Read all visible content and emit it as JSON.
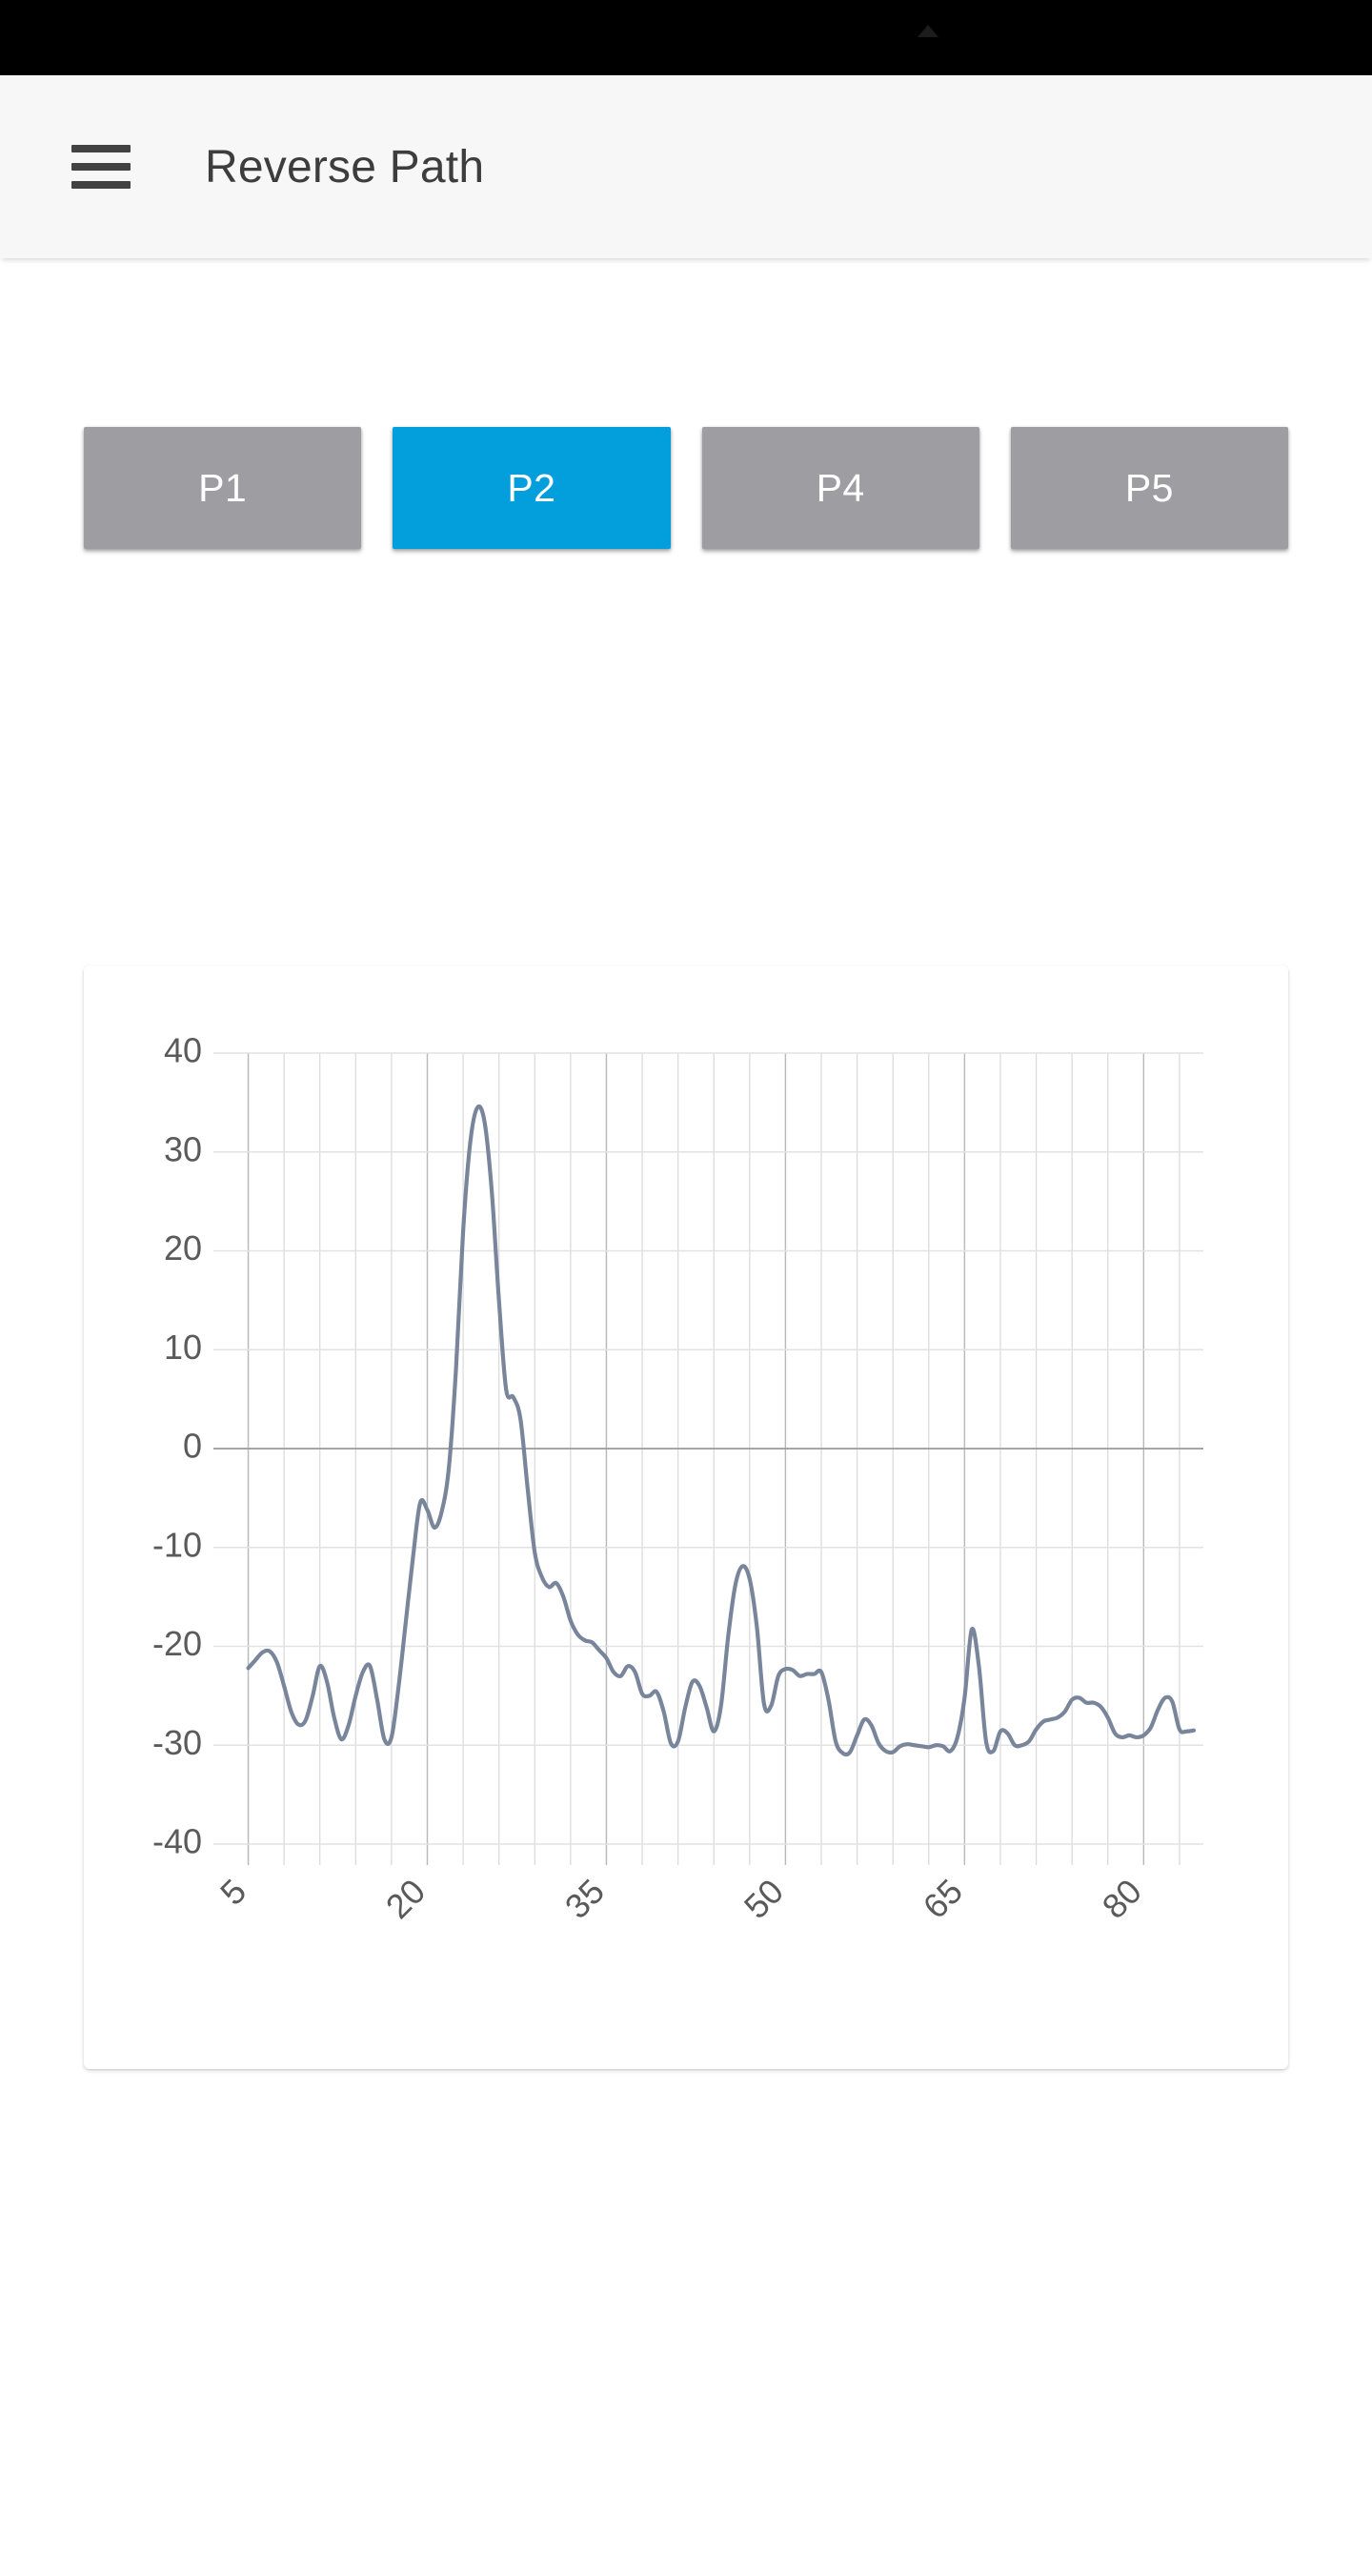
{
  "statusbar": {
    "notch_icon": "camera-notch"
  },
  "appbar": {
    "menu_icon": "hamburger-menu-icon",
    "title": "Reverse Path"
  },
  "buttons": [
    {
      "label": "P1",
      "active": false
    },
    {
      "label": "P2",
      "active": true
    },
    {
      "label": "P4",
      "active": false
    },
    {
      "label": "P5",
      "active": false
    }
  ],
  "colors": {
    "accent": "#039fdc",
    "inactive": "#9e9ea2",
    "line": "#78859b",
    "appbar_bg": "#f7f7f7",
    "statusbar_bg": "#000000",
    "text": "#3d3d3d",
    "tick_text": "#5a5a5a"
  },
  "chart_data": {
    "type": "line",
    "title": "",
    "xlabel": "",
    "ylabel": "",
    "xlim": [
      4,
      85
    ],
    "ylim": [
      -40,
      40
    ],
    "yticks": [
      40,
      30,
      20,
      10,
      0,
      -10,
      -20,
      -30,
      -40
    ],
    "ytick_labels": [
      "40",
      "30",
      "20",
      "10",
      "0",
      "-10",
      "-20",
      "-30",
      "-40"
    ],
    "xticks": [
      5,
      20,
      35,
      50,
      65,
      80
    ],
    "xtick_labels": [
      "5",
      "20",
      "35",
      "50",
      "65",
      "80"
    ],
    "xtick_rotation": -45,
    "grid": true,
    "grid_minor_x_step": 3,
    "legend": false,
    "series": [
      {
        "name": "P2",
        "color": "#78859b",
        "x": [
          5.0,
          5.6,
          6.2,
          6.8,
          7.4,
          8.0,
          8.6,
          9.2,
          9.8,
          10.4,
          11.0,
          11.6,
          12.2,
          12.8,
          13.4,
          14.0,
          14.6,
          15.2,
          15.8,
          16.4,
          17.0,
          17.6,
          18.2,
          18.8,
          19.4,
          20.0,
          20.6,
          21.2,
          21.8,
          22.4,
          23.0,
          23.6,
          24.2,
          24.8,
          25.4,
          26.0,
          26.6,
          27.2,
          27.8,
          28.4,
          29.0,
          29.6,
          30.2,
          30.8,
          31.4,
          32.0,
          32.6,
          33.2,
          33.8,
          34.4,
          35.0,
          35.6,
          36.2,
          36.8,
          37.4,
          38.0,
          38.6,
          39.2,
          39.8,
          40.4,
          41.0,
          41.6,
          42.2,
          42.8,
          43.4,
          44.0,
          44.6,
          45.2,
          45.8,
          46.4,
          47.0,
          47.6,
          48.2,
          48.8,
          49.4,
          50.0,
          50.6,
          51.2,
          51.8,
          52.4,
          53.0,
          53.6,
          54.2,
          54.8,
          55.4,
          56.0,
          56.6,
          57.2,
          57.8,
          58.4,
          59.0,
          59.6,
          60.2,
          60.8,
          61.4,
          62.0,
          62.6,
          63.2,
          63.8,
          64.4,
          65.0,
          65.6,
          66.2,
          66.8,
          67.4,
          68.0,
          68.6,
          69.2,
          69.8,
          70.4,
          71.0,
          71.6,
          72.2,
          72.8,
          73.4,
          74.0,
          74.6,
          75.2,
          75.8,
          76.4,
          77.0,
          77.6,
          78.2,
          78.8,
          79.4,
          80.0,
          80.6,
          81.2,
          81.8,
          82.4,
          83.0,
          83.6,
          84.2
        ],
        "y": [
          -22.2,
          -21.4,
          -20.6,
          -20.5,
          -21.6,
          -24.0,
          -26.6,
          -27.9,
          -27.5,
          -25.0,
          -22.0,
          -23.6,
          -27.2,
          -29.4,
          -28.0,
          -25.0,
          -22.6,
          -22.0,
          -25.4,
          -29.4,
          -29.2,
          -24.0,
          -17.5,
          -11.0,
          -5.5,
          -6.2,
          -8.0,
          -6.4,
          -2.0,
          8.0,
          22.0,
          31.0,
          34.5,
          33.0,
          26.0,
          15.0,
          6.0,
          5.2,
          3.0,
          -4.0,
          -10.5,
          -13.0,
          -14.0,
          -13.6,
          -15.0,
          -17.4,
          -18.8,
          -19.4,
          -19.6,
          -20.4,
          -21.2,
          -22.6,
          -23.0,
          -22.0,
          -22.6,
          -24.8,
          -25.0,
          -24.6,
          -26.6,
          -29.8,
          -29.6,
          -26.2,
          -23.6,
          -24.0,
          -26.2,
          -28.6,
          -26.0,
          -19.0,
          -13.8,
          -11.9,
          -13.2,
          -18.0,
          -25.8,
          -26.0,
          -23.0,
          -22.3,
          -22.4,
          -23.0,
          -22.8,
          -22.8,
          -22.6,
          -25.4,
          -29.6,
          -30.8,
          -30.7,
          -29.0,
          -27.4,
          -28.0,
          -29.8,
          -30.6,
          -30.7,
          -30.1,
          -29.9,
          -30.0,
          -30.1,
          -30.2,
          -30.0,
          -30.1,
          -30.6,
          -29.2,
          -25.2,
          -18.3,
          -22.0,
          -29.6,
          -30.6,
          -28.6,
          -28.8,
          -30.0,
          -30.0,
          -29.6,
          -28.4,
          -27.6,
          -27.4,
          -27.2,
          -26.6,
          -25.4,
          -25.2,
          -25.7,
          -25.7,
          -26.1,
          -27.2,
          -28.8,
          -29.2,
          -29.0,
          -29.2,
          -29.0,
          -28.2,
          -26.4,
          -25.2,
          -25.6,
          -28.4,
          -28.6,
          -28.5
        ]
      }
    ]
  }
}
